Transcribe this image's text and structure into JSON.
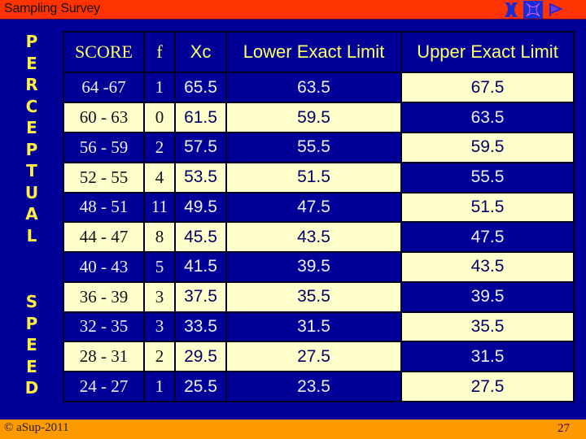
{
  "titlebar": {
    "title": "Sampling Survey"
  },
  "nav_icons": [
    "prev-icon",
    "next-icon",
    "flag-icon"
  ],
  "side_labels": {
    "top": "PERCEPTUAL",
    "bottom": "SPEED"
  },
  "table": {
    "headers": [
      "SCORE",
      "f",
      "Xc",
      "Lower Exact Limit",
      "Upper Exact Limit"
    ],
    "rows": [
      {
        "score": "64 -67",
        "f": "1",
        "xc": "65.5",
        "lower": "63.5",
        "upper": "67.5"
      },
      {
        "score": "60 - 63",
        "f": "0",
        "xc": "61.5",
        "lower": "59.5",
        "upper": "63.5"
      },
      {
        "score": "56 - 59",
        "f": "2",
        "xc": "57.5",
        "lower": "55.5",
        "upper": "59.5"
      },
      {
        "score": "52 - 55",
        "f": "4",
        "xc": "53.5",
        "lower": "51.5",
        "upper": "55.5"
      },
      {
        "score": "48 - 51",
        "f": "11",
        "xc": "49.5",
        "lower": "47.5",
        "upper": "51.5"
      },
      {
        "score": "44 - 47",
        "f": "8",
        "xc": "45.5",
        "lower": "43.5",
        "upper": "47.5"
      },
      {
        "score": "40 - 43",
        "f": "5",
        "xc": "41.5",
        "lower": "39.5",
        "upper": "43.5"
      },
      {
        "score": "36 - 39",
        "f": "3",
        "xc": "37.5",
        "lower": "35.5",
        "upper": "39.5"
      },
      {
        "score": "32 - 35",
        "f": "3",
        "xc": "33.5",
        "lower": "31.5",
        "upper": "35.5"
      },
      {
        "score": "28 - 31",
        "f": "2",
        "xc": "29.5",
        "lower": "27.5",
        "upper": "31.5"
      },
      {
        "score": "24 - 27",
        "f": "1",
        "xc": "25.5",
        "lower": "23.5",
        "upper": "27.5"
      }
    ]
  },
  "colors": {
    "background": "#000099",
    "titlebar": "#ff3300",
    "footer": "#ff9900",
    "header_text": "#ffff66",
    "cream": "#ffffcc"
  },
  "footer": {
    "copyright": "© aSup-2011",
    "page_number": "27"
  }
}
